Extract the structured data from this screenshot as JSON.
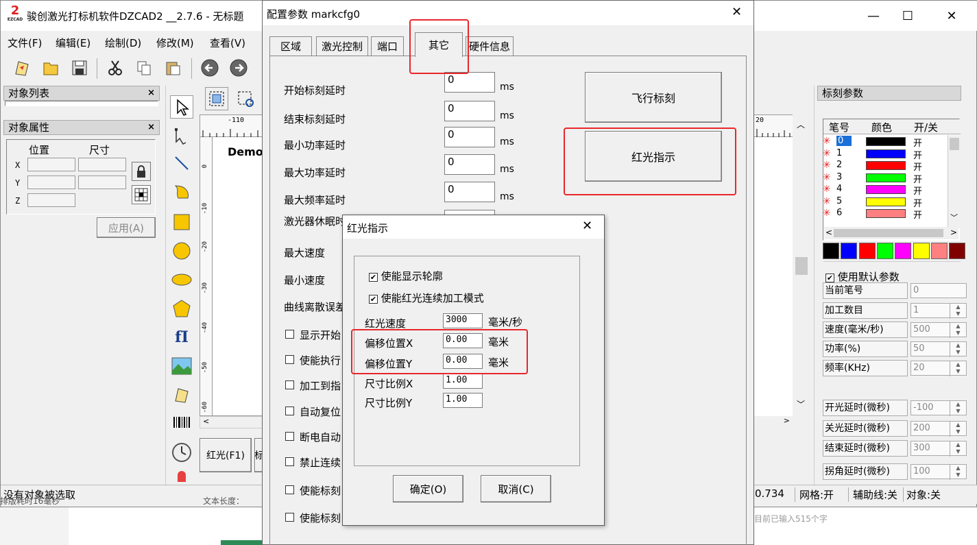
{
  "main_window": {
    "title": "骏创激光打标机软件DZCAD2 __2.7.6 - 无标题",
    "logo_text": "EZCAD",
    "menus": [
      "文件(F)",
      "编辑(E)",
      "绘制(D)",
      "修改(M)",
      "查看(V)"
    ],
    "object_list_title": "对象列表",
    "object_props_title": "对象属性",
    "position_label": "位置",
    "size_label": "尺寸",
    "axis_x": "X",
    "axis_y": "Y",
    "axis_z": "Z",
    "apply_button": "应用(A)",
    "canvas_text": "Demo",
    "ruler_h_left": "-110",
    "ruler_h_right": "20",
    "ruler_v_labels": [
      "0",
      "-10",
      "-20",
      "-30",
      "-40",
      "-50",
      "-60"
    ],
    "redlight_button": "红光(F1)",
    "redlight_button_partial": "标",
    "status_left": "没有对象被选取",
    "status_coord": "0.734",
    "status_grid": "网格:开",
    "status_guide": "辅助线:关",
    "status_object": "对象:关",
    "bg_text_left": "排版耗时16毫秒",
    "bg_text_middle": "文本长度：",
    "bg_text_right": "目前已输入515个字",
    "mark_params_title": "标刻参数",
    "pen_table_headers": [
      "笔号",
      "颜色",
      "开/关"
    ],
    "pens": [
      {
        "no": "0",
        "color": "#000000",
        "state": "开"
      },
      {
        "no": "1",
        "color": "#0000ff",
        "state": "开"
      },
      {
        "no": "2",
        "color": "#ff0000",
        "state": "开"
      },
      {
        "no": "3",
        "color": "#00ff00",
        "state": "开"
      },
      {
        "no": "4",
        "color": "#ff00ff",
        "state": "开"
      },
      {
        "no": "5",
        "color": "#ffff00",
        "state": "开"
      },
      {
        "no": "6",
        "color": "#ff8080",
        "state": "开"
      }
    ],
    "palette": [
      "#000000",
      "#0000ff",
      "#ff0000",
      "#00ff00",
      "#ff00ff",
      "#ffff00",
      "#ff8080",
      "#800000"
    ],
    "use_default_params": "使用默认参数",
    "params": [
      {
        "label": "当前笔号",
        "value": "0"
      },
      {
        "label": "加工数目",
        "value": "1"
      },
      {
        "label": "速度(毫米/秒)",
        "value": "500"
      },
      {
        "label": "功率(%)",
        "value": "50"
      },
      {
        "label": "频率(KHz)",
        "value": "20"
      },
      {
        "label": "开光延时(微秒)",
        "value": "-100"
      },
      {
        "label": "关光延时(微秒)",
        "value": "200"
      },
      {
        "label": "结束延时(微秒)",
        "value": "300"
      },
      {
        "label": "拐角延时(微秒)",
        "value": "100"
      }
    ]
  },
  "config_dialog": {
    "title": "配置参数 markcfg0",
    "tabs": [
      "区域",
      "激光控制",
      "端口",
      "其它",
      "硬件信息"
    ],
    "active_tab": "其它",
    "fields": [
      {
        "label": "开始标刻延时",
        "value": "0",
        "unit": "ms"
      },
      {
        "label": "结束标刻延时",
        "value": "0",
        "unit": "ms"
      },
      {
        "label": "最小功率延时",
        "value": "0",
        "unit": "ms"
      },
      {
        "label": "最大功率延时",
        "value": "0",
        "unit": "ms"
      },
      {
        "label": "最大频率延时",
        "value": "0",
        "unit": "ms"
      }
    ],
    "partial_labels": [
      "激光器休眠时间",
      "最大速度",
      "最小速度",
      "曲线离散误差"
    ],
    "check_partials": [
      "显示开始",
      "使能执行",
      "加工到指",
      "自动复位",
      "断电自动",
      "禁止连续",
      "使能标刻",
      "使能标刻"
    ],
    "fly_mark_button": "飞行标刻",
    "redlight_button": "红光指示"
  },
  "redlight_dialog": {
    "title": "红光指示",
    "enable_contour": "使能显示轮廓",
    "enable_continuous": "使能红光连续加工模式",
    "fields": [
      {
        "label": "红光速度",
        "value": "3000",
        "unit": "毫米/秒"
      },
      {
        "label": "偏移位置X",
        "value": "0.00",
        "unit": "毫米"
      },
      {
        "label": "偏移位置Y",
        "value": "0.00",
        "unit": "毫米"
      },
      {
        "label": "尺寸比例X",
        "value": "1.00",
        "unit": ""
      },
      {
        "label": "尺寸比例Y",
        "value": "1.00",
        "unit": ""
      }
    ],
    "ok_button": "确定(O)",
    "cancel_button": "取消(C)"
  }
}
